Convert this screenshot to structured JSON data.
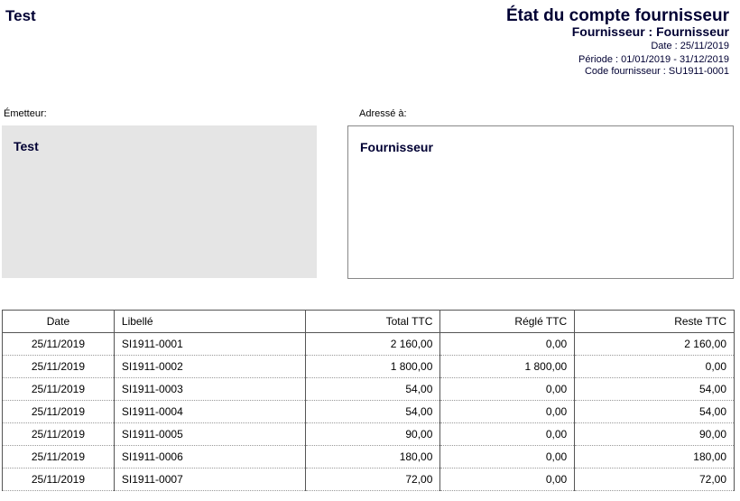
{
  "company": "Test",
  "header": {
    "title": "État du compte fournisseur",
    "subtitle": "Fournisseur : Fournisseur",
    "date": "Date : 25/11/2019",
    "period": "Période : 01/01/2019 - 31/12/2019",
    "code": "Code fournisseur : SU1911-0001"
  },
  "sender": {
    "label": "Émetteur:",
    "name": "Test"
  },
  "recipient": {
    "label": "Adressé à:",
    "name": "Fournisseur"
  },
  "table": {
    "columns": [
      "Date",
      "Libellé",
      "Total TTC",
      "Réglé TTC",
      "Reste TTC"
    ],
    "rows": [
      [
        "25/11/2019",
        "SI1911-0001",
        "2 160,00",
        "0,00",
        "2 160,00"
      ],
      [
        "25/11/2019",
        "SI1911-0002",
        "1 800,00",
        "1 800,00",
        "0,00"
      ],
      [
        "25/11/2019",
        "SI1911-0003",
        "54,00",
        "0,00",
        "54,00"
      ],
      [
        "25/11/2019",
        "SI1911-0004",
        "54,00",
        "0,00",
        "54,00"
      ],
      [
        "25/11/2019",
        "SI1911-0005",
        "90,00",
        "0,00",
        "90,00"
      ],
      [
        "25/11/2019",
        "SI1911-0006",
        "180,00",
        "0,00",
        "180,00"
      ],
      [
        "25/11/2019",
        "SI1911-0007",
        "72,00",
        "0,00",
        "72,00"
      ]
    ]
  }
}
